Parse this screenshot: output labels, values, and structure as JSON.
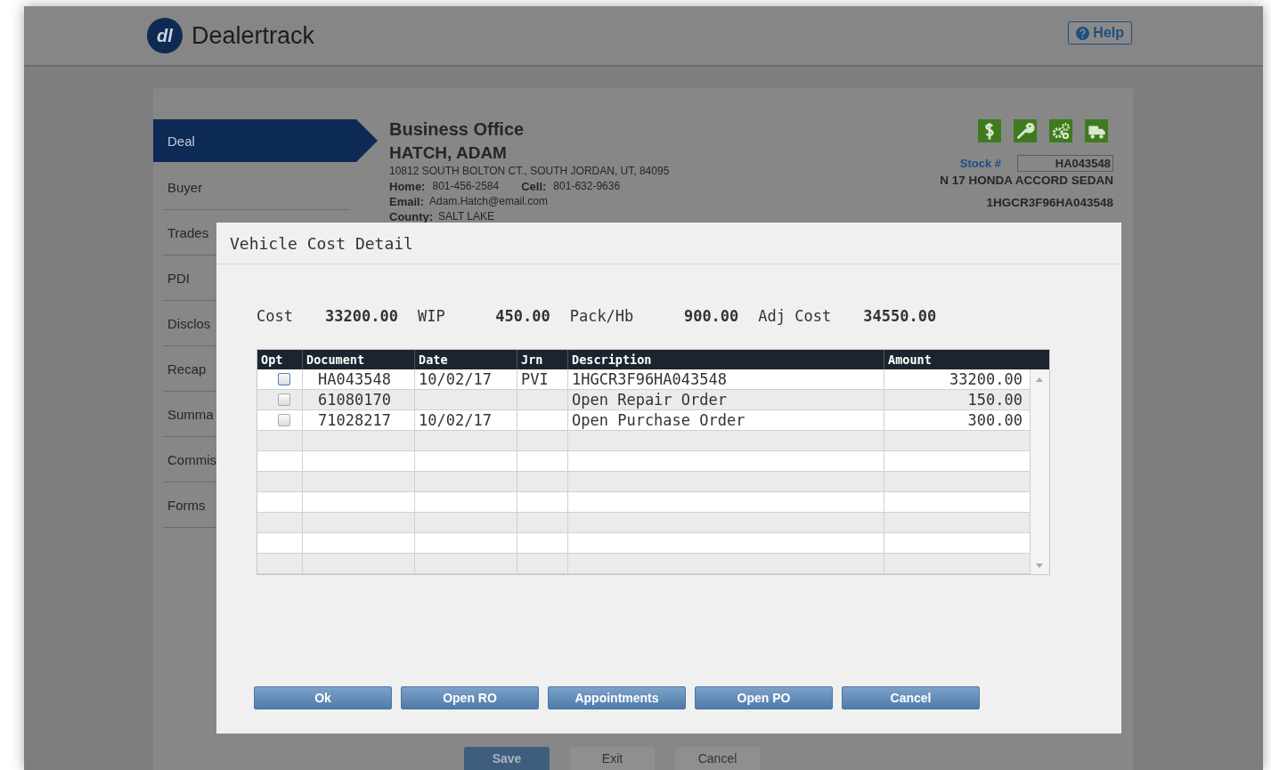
{
  "header": {
    "logo_mark": "dl",
    "logo_text": "Dealertrack",
    "help": "Help"
  },
  "sidebar": {
    "items": [
      {
        "label": "Deal",
        "selected": true
      },
      {
        "label": "Buyer",
        "selected": false
      },
      {
        "label": "Trades",
        "selected": false
      },
      {
        "label": "PDI",
        "selected": false
      },
      {
        "label": "Disclos",
        "selected": false
      },
      {
        "label": "Recap",
        "selected": false
      },
      {
        "label": "Summa",
        "selected": false
      },
      {
        "label": "Commis",
        "selected": false
      },
      {
        "label": "Forms",
        "selected": false
      }
    ]
  },
  "customer": {
    "office": "Business Office",
    "name": "HATCH, ADAM",
    "address": "10812 SOUTH BOLTON CT., SOUTH JORDAN, UT, 84095",
    "phones": [
      {
        "label": "Home:",
        "value": "801-456-2584"
      },
      {
        "label": "Cell:",
        "value": "801-632-9636"
      }
    ],
    "email": {
      "label": "Email:",
      "value": "Adam.Hatch@email.com"
    },
    "county": {
      "label": "County:",
      "value": "SALT LAKE"
    }
  },
  "vehicle": {
    "stock_label": "Stock #",
    "stock": "HA043548",
    "description": "N 17 HONDA ACCORD SEDAN",
    "vin": "1HGCR3F96HA043548"
  },
  "dialog": {
    "title": "Vehicle Cost Detail",
    "summary": [
      {
        "label": "Cost",
        "value": "33200.00"
      },
      {
        "label": "WIP",
        "value": "450.00"
      },
      {
        "label": "Pack/Hb",
        "value": "900.00"
      },
      {
        "label": "Adj Cost",
        "value": "34550.00"
      }
    ],
    "table": {
      "columns": [
        "Opt",
        "Document",
        "Date",
        "Jrn",
        "Description",
        "Amount"
      ],
      "rows": [
        {
          "checked": false,
          "focused": true,
          "cells": [
            "",
            "HA043548",
            "10/02/17",
            "PVI",
            "1HGCR3F96HA043548",
            "33200.00"
          ]
        },
        {
          "checked": false,
          "focused": false,
          "cells": [
            "",
            "61080170",
            "",
            "",
            "Open Repair Order",
            "150.00"
          ]
        },
        {
          "checked": false,
          "focused": false,
          "cells": [
            "",
            "71028217",
            "10/02/17",
            "",
            "Open Purchase Order",
            "300.00"
          ]
        }
      ]
    },
    "buttons": [
      "Ok",
      "Open RO",
      "Appointments",
      "Open PO",
      "Cancel"
    ]
  },
  "footer_buttons": [
    {
      "label": "Save",
      "kind": "primary"
    },
    {
      "label": "Exit",
      "kind": "secondary"
    },
    {
      "label": "Cancel",
      "kind": "secondary"
    }
  ]
}
